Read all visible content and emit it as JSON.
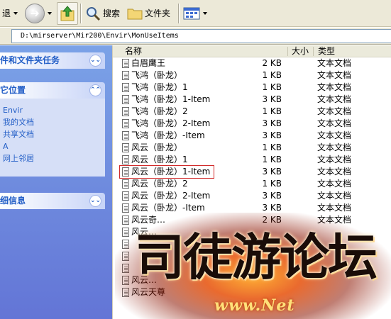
{
  "toolbar": {
    "back_label": "退",
    "search_label": "搜索",
    "folders_label": "文件夹"
  },
  "address": {
    "path": "D:\\mirserver\\Mir200\\Envir\\MonUseItems"
  },
  "left_panel": {
    "tasks_header": "件和文件夹任务",
    "places_header": "它位置",
    "places_items": [
      "Envir",
      "我的文档",
      "共享文档",
      "A",
      "网上邻居"
    ],
    "details_header": "细信息"
  },
  "list": {
    "columns": {
      "name": "名称",
      "size": "大小",
      "type": "类型"
    },
    "rows": [
      {
        "name": "白眉鹰王",
        "size": "2 KB",
        "type": "文本文档"
      },
      {
        "name": "飞鸿（卧龙）",
        "size": "1 KB",
        "type": "文本文档"
      },
      {
        "name": "飞鸿（卧龙）1",
        "size": "1 KB",
        "type": "文本文档"
      },
      {
        "name": "飞鸿（卧龙）1-Item",
        "size": "3 KB",
        "type": "文本文档"
      },
      {
        "name": "飞鸿（卧龙）2",
        "size": "1 KB",
        "type": "文本文档"
      },
      {
        "name": "飞鸿（卧龙）2-Item",
        "size": "3 KB",
        "type": "文本文档"
      },
      {
        "name": "飞鸿（卧龙）-Item",
        "size": "3 KB",
        "type": "文本文档"
      },
      {
        "name": "风云（卧龙）",
        "size": "1 KB",
        "type": "文本文档"
      },
      {
        "name": "风云（卧龙）1",
        "size": "1 KB",
        "type": "文本文档"
      },
      {
        "name": "风云（卧龙）1-Item",
        "size": "3 KB",
        "type": "文本文档"
      },
      {
        "name": "风云（卧龙）2",
        "size": "1 KB",
        "type": "文本文档"
      },
      {
        "name": "风云（卧龙）2-Item",
        "size": "3 KB",
        "type": "文本文档"
      },
      {
        "name": "风云（卧龙）-Item",
        "size": "3 KB",
        "type": "文本文档"
      },
      {
        "name": "风云奇…",
        "size": "2 KB",
        "type": "文本文档"
      },
      {
        "name": "风云…",
        "size": "",
        "type": ""
      },
      {
        "name": "",
        "size": "",
        "type": ""
      },
      {
        "name": "",
        "size": "",
        "type": ""
      },
      {
        "name": "",
        "size": "",
        "type": ""
      },
      {
        "name": "风云…",
        "size": "",
        "type": ""
      },
      {
        "name": "风云天尊",
        "size": "",
        "type": ""
      }
    ]
  },
  "watermark": {
    "title": "司徒游论坛",
    "url": "www.Net"
  }
}
